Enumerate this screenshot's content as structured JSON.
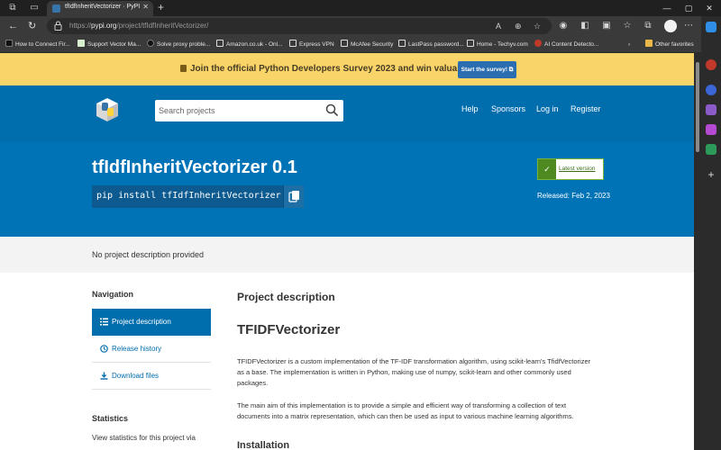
{
  "browser": {
    "tab_title": "tfIdfInheritVectorizer · PyPI",
    "url_domain": "pypi.org",
    "url_path": "/project/tfIdfInheritVectorizer/",
    "url_scheme": "https://",
    "bookmarks": [
      {
        "label": "How to Connect Fir...",
        "icon": "am-icon",
        "color": "#111111"
      },
      {
        "label": "Support Vector Ma...",
        "icon": "page-icon",
        "color": "#d9f0d0"
      },
      {
        "label": "Solve proxy proble...",
        "icon": "cb-icon",
        "color": "#111111"
      },
      {
        "label": "Amazon.co.uk - Onl...",
        "icon": "doc-icon",
        "color": "#dddddd"
      },
      {
        "label": "Express VPN",
        "icon": "doc-icon",
        "color": "#dddddd"
      },
      {
        "label": "McAfee Security",
        "icon": "doc-icon",
        "color": "#dddddd"
      },
      {
        "label": "LastPass password...",
        "icon": "doc-icon",
        "color": "#dddddd"
      },
      {
        "label": "Home - Techyv.com",
        "icon": "doc-icon",
        "color": "#dddddd"
      },
      {
        "label": "AI Content Detecto...",
        "icon": "ai-icon",
        "color": "#c0392b"
      }
    ],
    "other_favorites": "Other favorites"
  },
  "banner": {
    "text": "Join the official Python Developers Survey 2023 and win valuable prizes.",
    "button": "Start the survey!"
  },
  "header": {
    "search_placeholder": "Search projects",
    "nav": [
      "Help",
      "Sponsors",
      "Log in",
      "Register"
    ]
  },
  "hero": {
    "title": "tfIdfInheritVectorizer 0.1",
    "pip_command": "pip install tfIdfInheritVectorizer",
    "latest_label": "Latest version",
    "released": "Released: Feb 2, 2023"
  },
  "summary": "No project description provided",
  "sidebar": {
    "navigation_heading": "Navigation",
    "items": [
      {
        "label": "Project description",
        "active": true
      },
      {
        "label": "Release history",
        "active": false
      },
      {
        "label": "Download files",
        "active": false
      }
    ],
    "statistics_heading": "Statistics",
    "statistics_text": "View statistics for this project via"
  },
  "content": {
    "heading": "Project description",
    "title": "TFIDFVectorizer",
    "paragraph_1": "TFIDFVectorizer is a custom implementation of the TF-IDF transformation algorithm, using scikit-learn's TfidfVectorizer as a base. The implementation is written in Python, making use of numpy, scikit-learn and other commonly used packages.",
    "paragraph_2": "The main aim of this implementation is to provide a simple and efficient way of transforming a collection of text documents into a matrix representation, which can then be used as input to various machine learning algorithms.",
    "next_heading": "Installation"
  },
  "colors": {
    "pypi_blue": "#006dad",
    "banner_yellow": "#f9d468",
    "latest_green": "#4d8a1f"
  }
}
